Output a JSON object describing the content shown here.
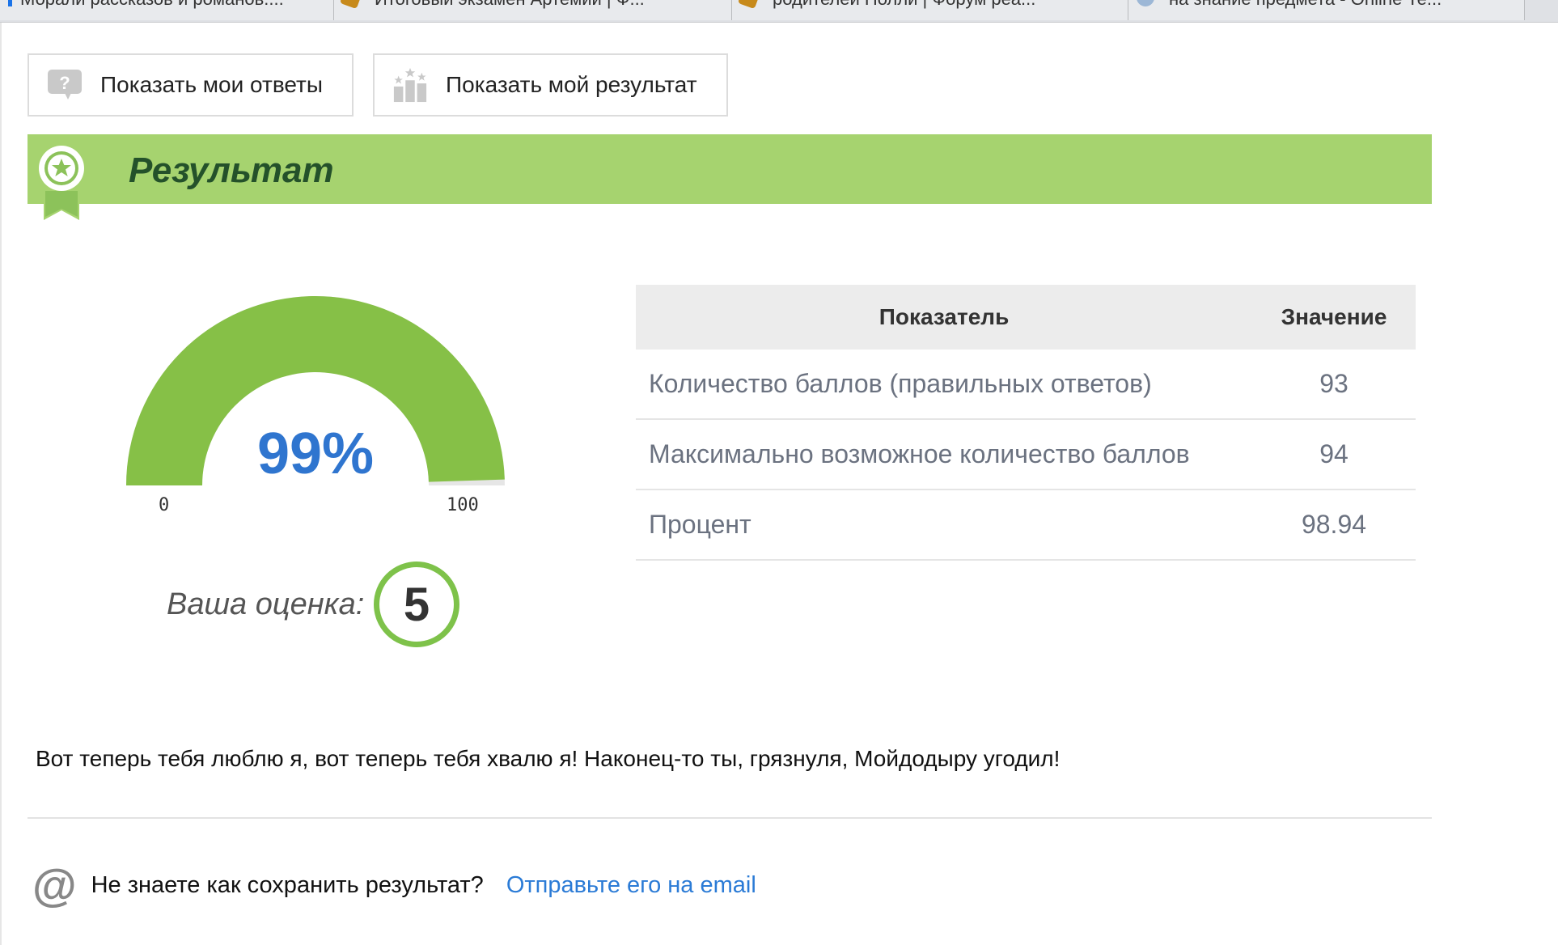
{
  "browser": {
    "tabs": [
      {
        "title": "Морали рассказов и романов...."
      },
      {
        "title": "Итоговый экзамен Артемии | Ф..."
      },
      {
        "title": "родителей Полли | Форум реа..."
      },
      {
        "title": "на знание предмета - Online Те..."
      }
    ]
  },
  "toolbar": {
    "show_answers_label": "Показать мои ответы",
    "show_result_label": "Показать мой результат"
  },
  "result": {
    "title": "Результат",
    "gauge": {
      "value_text": "99%",
      "value": 99,
      "min": "0",
      "max": "100"
    },
    "grade_label": "Ваша оценка:",
    "grade": "5"
  },
  "stats_table": {
    "headers": {
      "indicator": "Показатель",
      "value": "Значение"
    },
    "rows": [
      {
        "name": "Количество баллов (правильных ответов)",
        "value": "93"
      },
      {
        "name": "Максимально возможное количество баллов",
        "value": "94"
      },
      {
        "name": "Процент",
        "value": "98.94"
      }
    ]
  },
  "message": "Вот теперь тебя люблю я, вот теперь тебя хвалю я! Наконец-то ты, грязнуля, Мойдодыру угодил!",
  "save": {
    "question": "Не знаете как сохранить результат?",
    "link": "Отправьте его на email"
  },
  "colors": {
    "banner": "#a6d36f",
    "gauge_fill": "#86c047",
    "gauge_value": "#2f75cf",
    "link": "#2b7bd6"
  }
}
